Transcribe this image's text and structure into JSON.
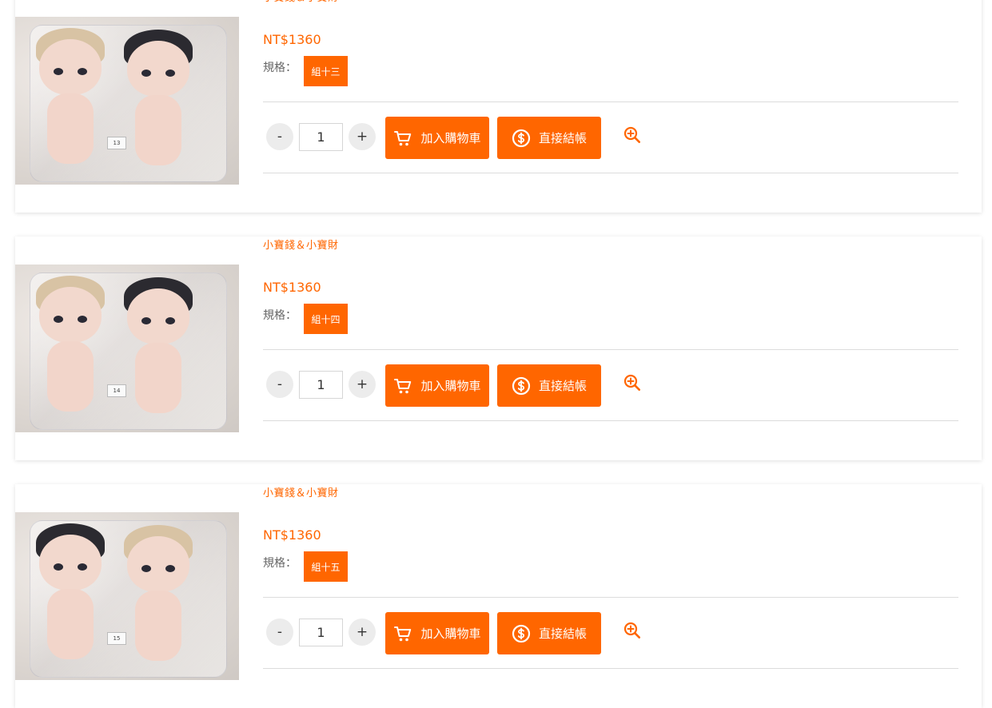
{
  "products": [
    {
      "brand": "小寶錢＆小寶財",
      "price": "NT$1360",
      "spec_label": "規格：",
      "spec_option": "組十三",
      "quantity": "1",
      "minus_label": "-",
      "plus_label": "+",
      "add_to_cart_label": "加入購物車",
      "checkout_label": "直接結帳",
      "photo_tag": "13",
      "photo_layout": "blonde-left"
    },
    {
      "brand": "小寶錢＆小寶財",
      "price": "NT$1360",
      "spec_label": "規格：",
      "spec_option": "組十四",
      "quantity": "1",
      "minus_label": "-",
      "plus_label": "+",
      "add_to_cart_label": "加入購物車",
      "checkout_label": "直接結帳",
      "photo_tag": "14",
      "photo_layout": "blonde-left"
    },
    {
      "brand": "小寶錢＆小寶財",
      "price": "NT$1360",
      "spec_label": "規格：",
      "spec_option": "組十五",
      "quantity": "1",
      "minus_label": "-",
      "plus_label": "+",
      "add_to_cart_label": "加入購物車",
      "checkout_label": "直接結帳",
      "photo_tag": "15",
      "photo_layout": "dark-left"
    }
  ],
  "icons": {
    "cart": "shopping-cart-icon",
    "checkout": "dollar-coin-icon",
    "zoom": "zoom-in-icon"
  },
  "colors": {
    "accent": "#ff6600",
    "blonde_hair": "#d8c3a4",
    "dark_hair": "#2b2a30"
  }
}
